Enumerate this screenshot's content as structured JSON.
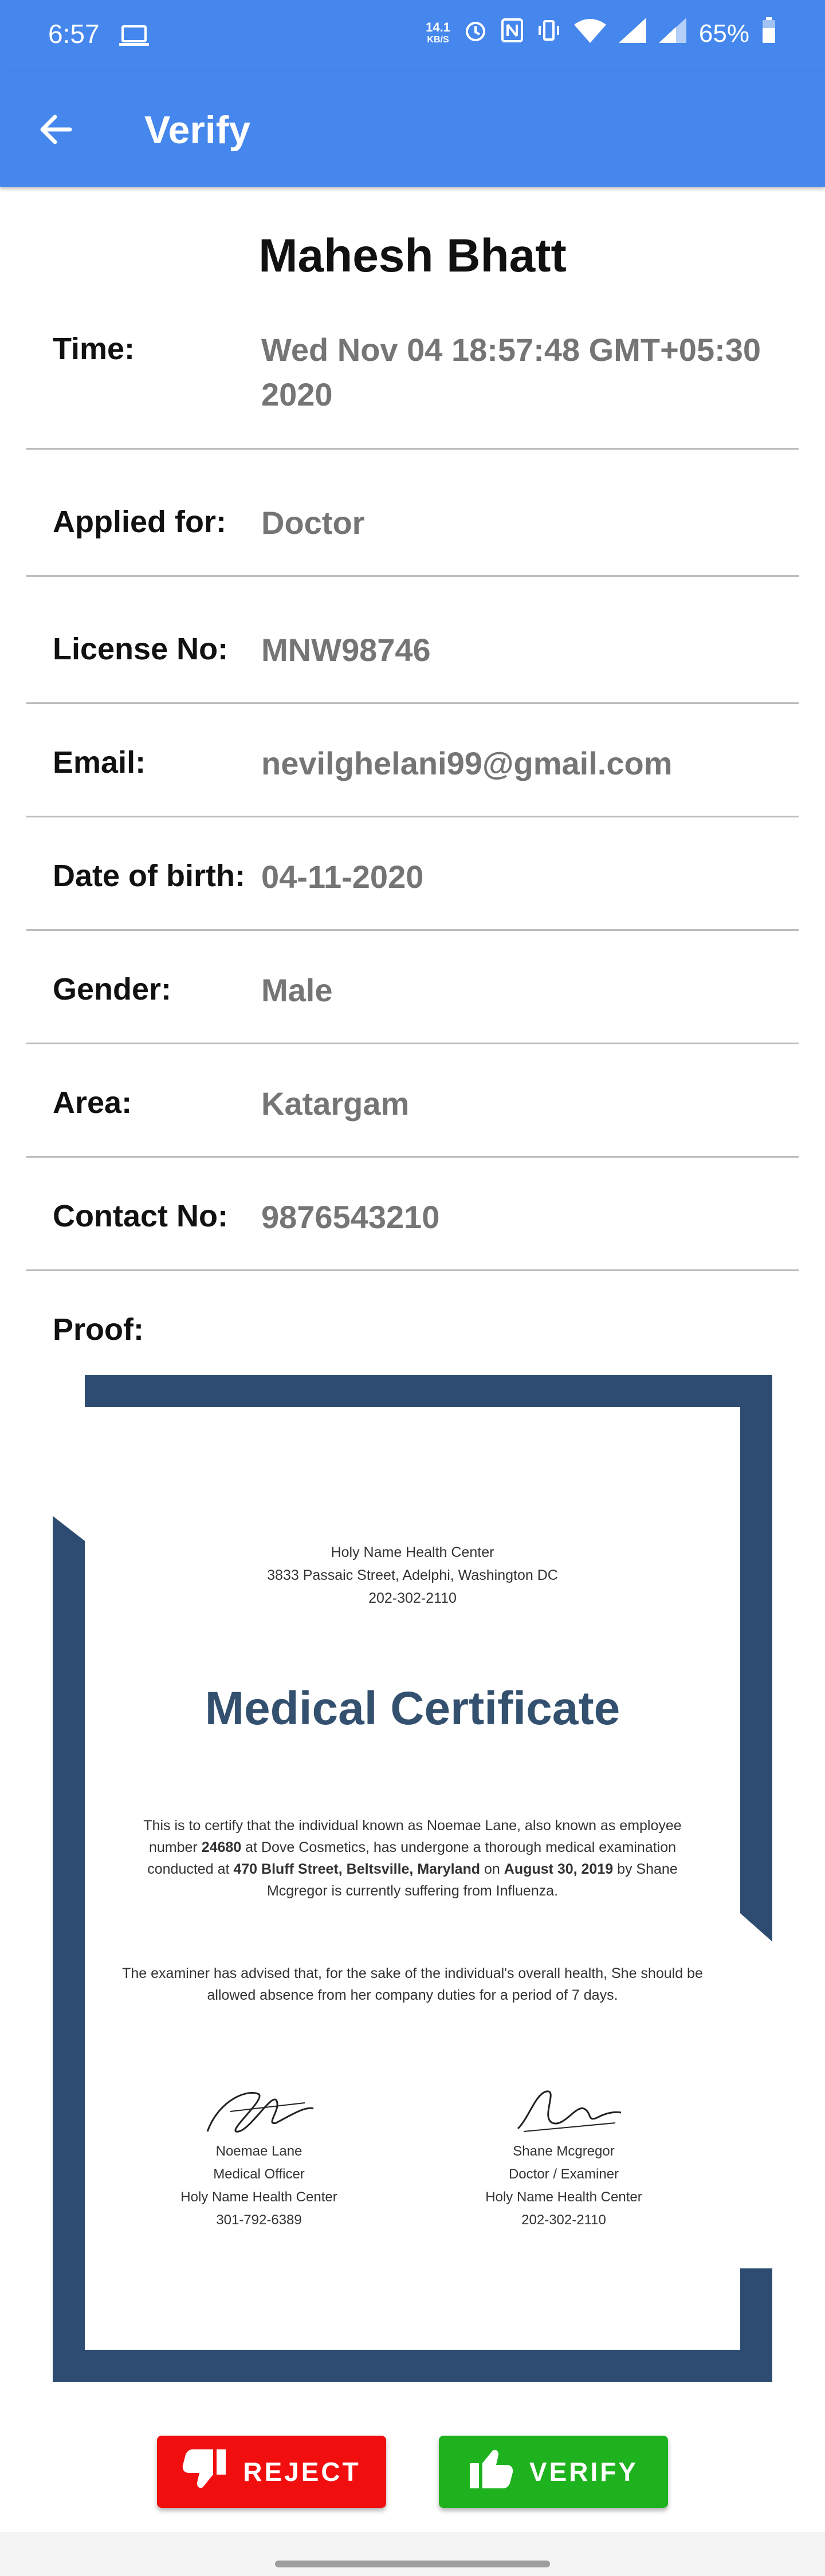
{
  "status_bar": {
    "time": "6:57",
    "speed_value": "14.1",
    "speed_unit": "KB/S",
    "battery": "65%"
  },
  "app_bar": {
    "title": "Verify"
  },
  "applicant": {
    "name": "Mahesh Bhatt",
    "fields": [
      {
        "label": "Time:",
        "value": "Wed Nov 04 18:57:48 GMT+05:30 2020"
      },
      {
        "label": "Applied for:",
        "value": "Doctor"
      },
      {
        "label": "License No:",
        "value": "MNW98746"
      },
      {
        "label": "Email:",
        "value": "nevilghelani99@gmail.com"
      },
      {
        "label": "Date of birth:",
        "value": "04-11-2020"
      },
      {
        "label": "Gender:",
        "value": "Male"
      },
      {
        "label": "Area:",
        "value": "Katargam"
      },
      {
        "label": "Contact No:",
        "value": "9876543210"
      }
    ],
    "proof_label": "Proof:"
  },
  "certificate": {
    "org_name": "Holy Name Health Center",
    "org_address": "3833 Passaic Street, Adelphi, Washington DC",
    "org_phone": "202-302-2110",
    "title": "Medical Certificate",
    "body_parts": [
      "This is to certify that the individual known as Noemae Lane, also known as employee number ",
      "24680",
      " at Dove Cosmetics, has undergone a thorough medical examination conducted at ",
      "470 Bluff Street, Beltsville, Maryland",
      " on ",
      "August 30, 2019",
      " by Shane Mcgregor is currently suffering from Influenza."
    ],
    "body2": "The examiner has advised that, for the sake of the individual's overall health, She should be allowed absence from her company duties for a period of 7 days.",
    "signatory_left": {
      "name": "Noemae Lane",
      "role": "Medical Officer",
      "org": "Holy Name Health Center",
      "phone": "301-792-6389"
    },
    "signatory_right": {
      "name": "Shane Mcgregor",
      "role": "Doctor / Examiner",
      "org": "Holy Name Health Center",
      "phone": "202-302-2110"
    }
  },
  "actions": {
    "reject_label": "REJECT",
    "verify_label": "VERIFY",
    "reject_color": "#F10E0E",
    "verify_color": "#1EB31E"
  },
  "theme": {
    "primary": "#4587ED",
    "certificate_border": "#2E4C72"
  }
}
